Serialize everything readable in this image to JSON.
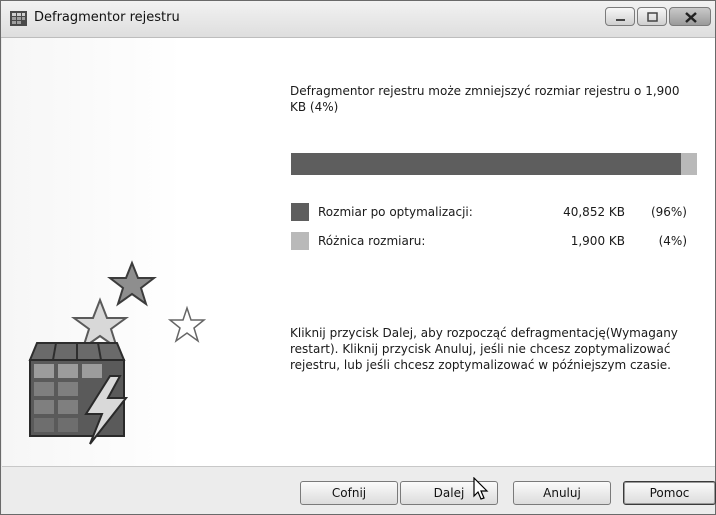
{
  "window": {
    "title": "Defragmentor rejestru",
    "icons": {
      "app": "registry-app-icon",
      "minimize": "minimize-icon",
      "maximize": "maximize-icon",
      "close": "close-icon"
    }
  },
  "main": {
    "intro_text": "Defragmentor rejestru może zmniejszyć rozmiar rejestru o 1,900 KB (4%)",
    "progress": {
      "optimized_fraction": 0.96
    },
    "legend": [
      {
        "label": "Rozmiar po optymalizacji:",
        "size": "40,852 KB",
        "percent": "(96%)",
        "color": "#5e5e5e"
      },
      {
        "label": "Różnica rozmiaru:",
        "size": "1,900 KB",
        "percent": "(4%)",
        "color": "#b9b9b9"
      }
    ],
    "instructions": "Kliknij przycisk Dalej, aby rozpocząć defragmentację(Wymagany restart). Kliknij przycisk Anuluj, jeśli nie chcesz zoptymalizować rejestru, lub jeśli chcesz zoptymalizować w późniejszym czasie.",
    "illustration": "registry-stars-lightning-icon"
  },
  "footer": {
    "back_label": "Cofnij",
    "next_label": "Dalej",
    "cancel_label": "Anuluj",
    "help_label": "Pomoc"
  }
}
